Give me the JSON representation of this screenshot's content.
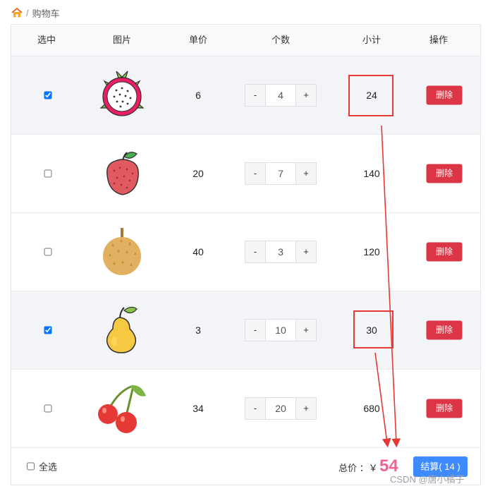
{
  "breadcrumb": {
    "home_icon": "home-icon",
    "separator": "/",
    "current": "购物车"
  },
  "table": {
    "headers": [
      "选中",
      "图片",
      "单价",
      "个数",
      "小计",
      "操作"
    ],
    "stepper": {
      "minus": "-",
      "plus": "+"
    },
    "delete_label": "删除",
    "rows": [
      {
        "checked": true,
        "fruit": "dragon-fruit-image",
        "price": "6",
        "count": "4",
        "subtotal": "24"
      },
      {
        "checked": false,
        "fruit": "lychee-image",
        "price": "20",
        "count": "7",
        "subtotal": "140"
      },
      {
        "checked": false,
        "fruit": "durian-image",
        "price": "40",
        "count": "3",
        "subtotal": "120"
      },
      {
        "checked": true,
        "fruit": "pear-image",
        "price": "3",
        "count": "10",
        "subtotal": "30"
      },
      {
        "checked": false,
        "fruit": "cherry-image",
        "price": "34",
        "count": "20",
        "subtotal": "680"
      }
    ]
  },
  "footer": {
    "select_all_label": "全选",
    "select_all_checked": false,
    "total_label": "总价 ：￥",
    "total_value": "54",
    "checkout_label": "结算( 14 )"
  },
  "watermark": "CSDN @唐小橘子",
  "colors": {
    "accent": "#3d8bfd",
    "danger": "#dc3545",
    "total": "#f06292",
    "annotation": "#e53935",
    "row_selected": "#f3f4f8"
  }
}
